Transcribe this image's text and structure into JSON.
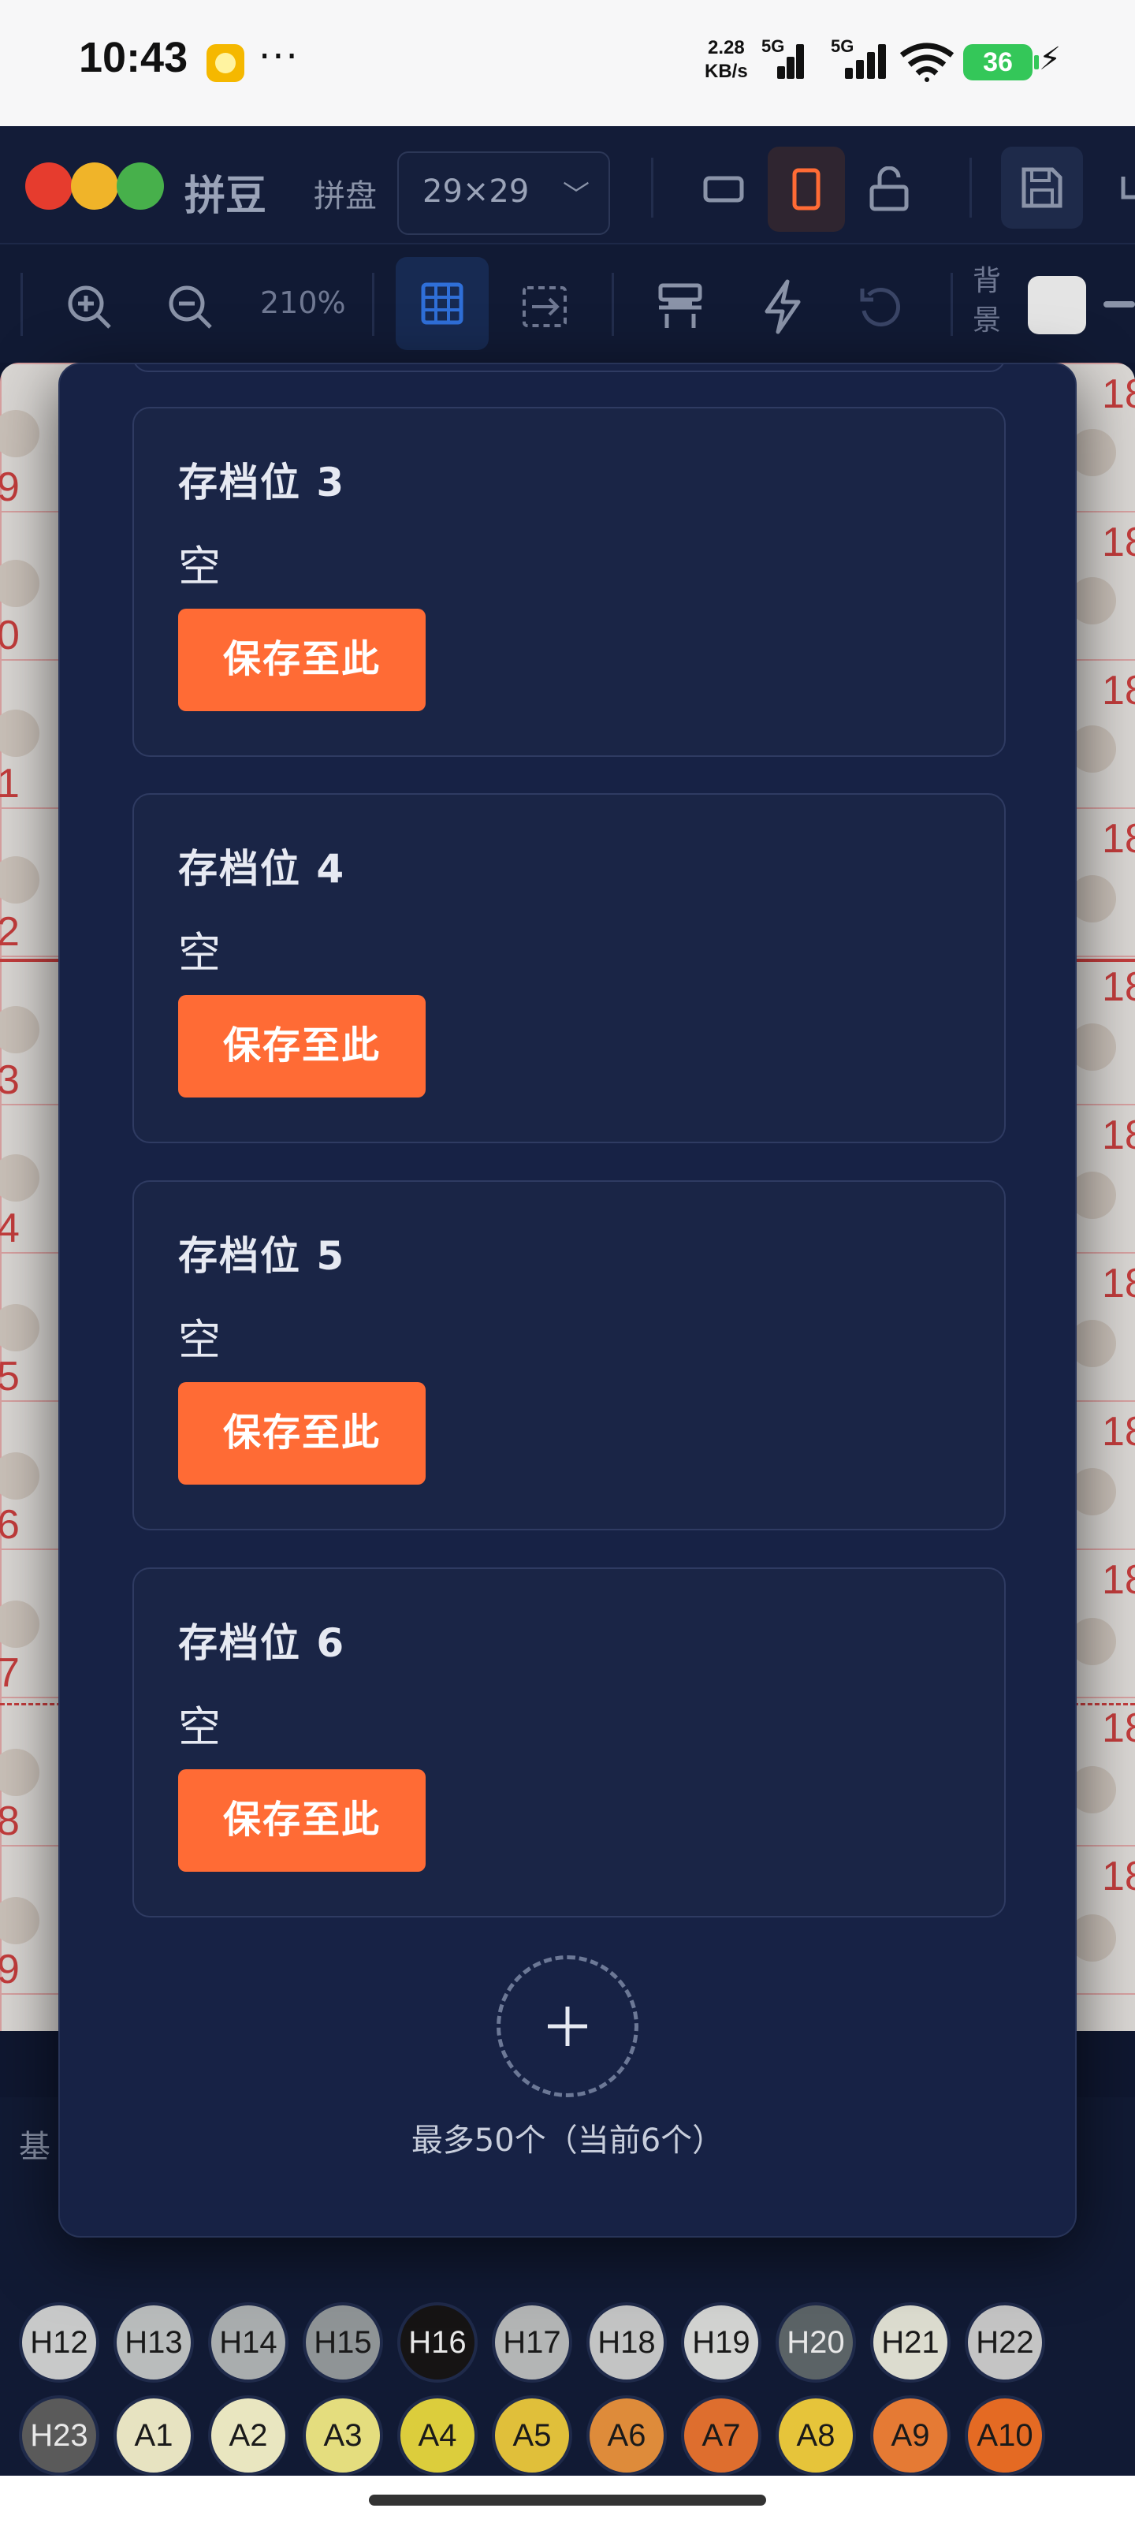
{
  "status_bar": {
    "time": "10:43",
    "more": "···",
    "speed_value": "2.28",
    "speed_unit": "KB/s",
    "net1": "5G",
    "net2": "5G",
    "battery": "36"
  },
  "app_bar": {
    "title": "拼豆",
    "board_label": "拼盘",
    "board_size": "29×29",
    "logo_colors": [
      "#e63c2e",
      "#f0b429",
      "#47b04b"
    ]
  },
  "toolbar": {
    "zoom_level": "210%",
    "background_label": "背景"
  },
  "canvas": {
    "row_numbers": [
      "9",
      "0",
      "1",
      "2",
      "3",
      "4",
      "5",
      "6",
      "7",
      "8",
      "9"
    ],
    "col_label": "18"
  },
  "modal": {
    "slots": [
      {
        "title": "存档位 3",
        "status": "空",
        "button": "保存至此"
      },
      {
        "title": "存档位 4",
        "status": "空",
        "button": "保存至此"
      },
      {
        "title": "存档位 5",
        "status": "空",
        "button": "保存至此"
      },
      {
        "title": "存档位 6",
        "status": "空",
        "button": "保存至此"
      }
    ],
    "limit_note": "最多50个（当前6个）"
  },
  "palette": {
    "label": "基",
    "row2": [
      {
        "code": "H12",
        "color": "#c8c9c9"
      },
      {
        "code": "H13",
        "color": "#b9bcbc"
      },
      {
        "code": "H14",
        "color": "#a9adae"
      },
      {
        "code": "H15",
        "color": "#8f9496"
      },
      {
        "code": "H16",
        "color": "#161414"
      },
      {
        "code": "H17",
        "color": "#b3b5b5"
      },
      {
        "code": "H18",
        "color": "#c3c4c4"
      },
      {
        "code": "H19",
        "color": "#d2d3d1"
      },
      {
        "code": "H20",
        "color": "#5b6366"
      },
      {
        "code": "H21",
        "color": "#dcdccf"
      },
      {
        "code": "H22",
        "color": "#c4c4c4"
      }
    ],
    "row3": [
      {
        "code": "H23",
        "color": "#5a5a5a"
      },
      {
        "code": "A1",
        "color": "#e7e3c1"
      },
      {
        "code": "A2",
        "color": "#e9e6c0"
      },
      {
        "code": "A3",
        "color": "#e4dd7e"
      },
      {
        "code": "A4",
        "color": "#dccd3c"
      },
      {
        "code": "A5",
        "color": "#e0bf3a"
      },
      {
        "code": "A6",
        "color": "#de8b3a"
      },
      {
        "code": "A7",
        "color": "#de6e2e"
      },
      {
        "code": "A8",
        "color": "#e6c43a"
      },
      {
        "code": "A9",
        "color": "#e57a34"
      },
      {
        "code": "A10",
        "color": "#e46a23"
      }
    ]
  }
}
